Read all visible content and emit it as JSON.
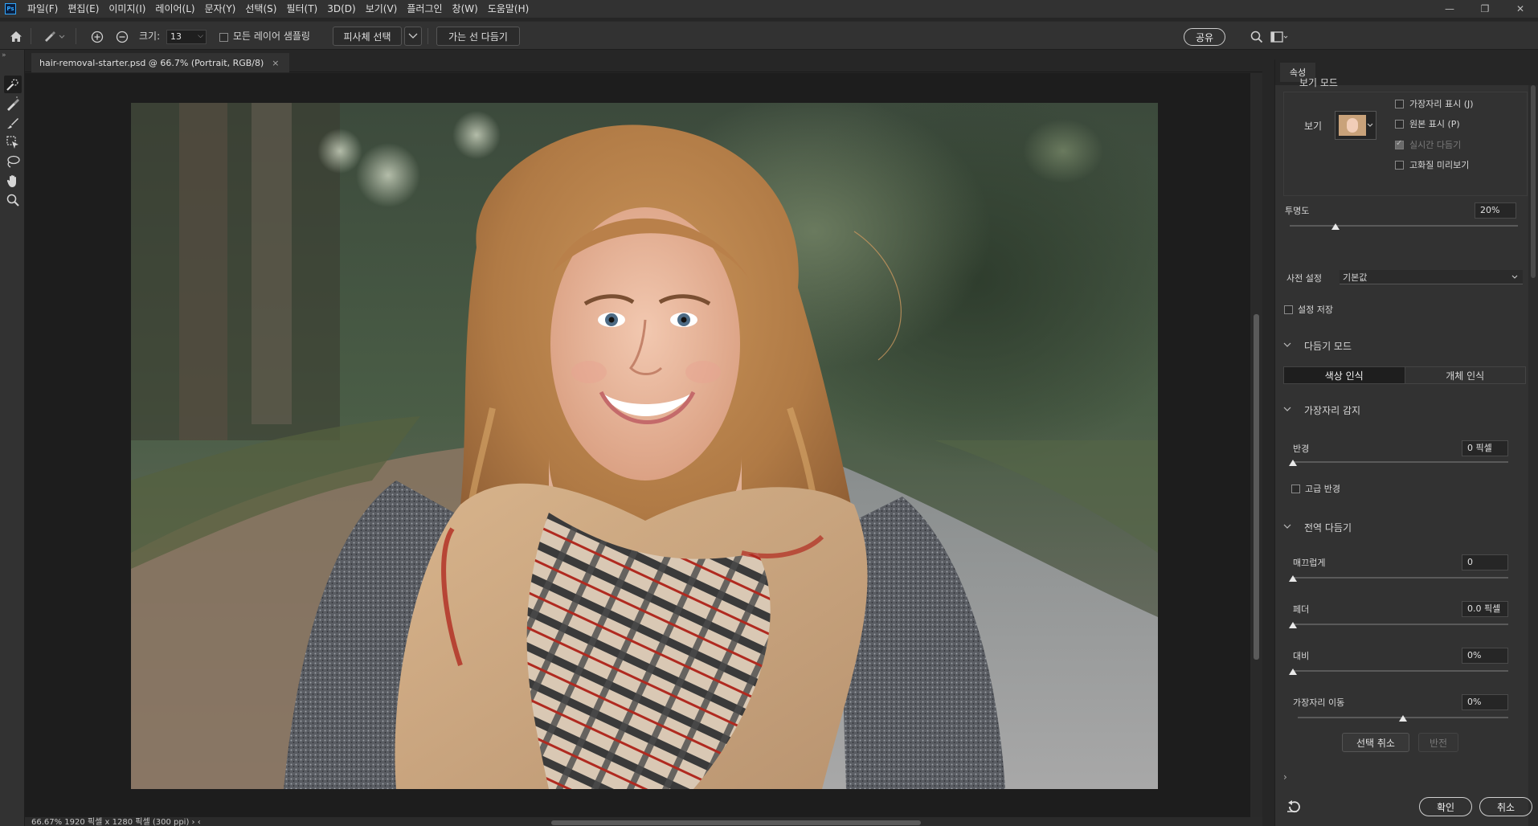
{
  "app": {
    "logo": "Ps"
  },
  "menu": [
    "파일(F)",
    "편집(E)",
    "이미지(I)",
    "레이어(L)",
    "문자(Y)",
    "선택(S)",
    "필터(T)",
    "3D(D)",
    "보기(V)",
    "플러그인",
    "창(W)",
    "도움말(H)"
  ],
  "window_controls": {
    "minimize": "—",
    "restore": "❐",
    "close": "✕"
  },
  "options": {
    "size_label": "크기:",
    "size_value": "13",
    "sample_all_layers": "모든 레이어 샘플링",
    "select_subject": "피사체 선택",
    "refine_hair": "가는 선 다듬기",
    "share": "공유"
  },
  "document": {
    "tab_title": "hair-removal-starter.psd @ 66.7% (Portrait, RGB/8)",
    "tab_close": "×",
    "status": "66.67%    1920 픽셀 x 1280 픽셀 (300 ppi)    ›   ‹"
  },
  "panel": {
    "tab": "속성",
    "view_mode_title": "보기 모드",
    "view_label": "보기",
    "show_edge": "가장자리 표시 (J)",
    "show_original": "원본 표시 (P)",
    "realtime_refine": "실시간 다듬기",
    "hq_preview": "고화질 미리보기",
    "opacity_label": "투명도",
    "opacity_value": "20%",
    "opacity_level": 0.2,
    "preset_label": "사전 설정",
    "preset_value": "기본값",
    "save_settings": "설정 저장",
    "refine_mode_title": "다듬기 모드",
    "refine_color_aware": "색상 인식",
    "refine_object_aware": "개체 인식",
    "edge_detection_title": "가장자리 감지",
    "radius_label": "반경",
    "radius_value": "0 픽셀",
    "smart_radius": "고급 반경",
    "global_refine_title": "전역 다듬기",
    "smooth_label": "매끄럽게",
    "smooth_value": "0",
    "feather_label": "페더",
    "feather_value": "0.0 픽셀",
    "contrast_label": "대비",
    "contrast_value": "0%",
    "shift_edge_label": "가장자리 이동",
    "shift_edge_value": "0%",
    "clear_selection": "선택 취소",
    "invert": "반전",
    "output_chevron": "›",
    "ok": "확인",
    "cancel": "취소"
  }
}
